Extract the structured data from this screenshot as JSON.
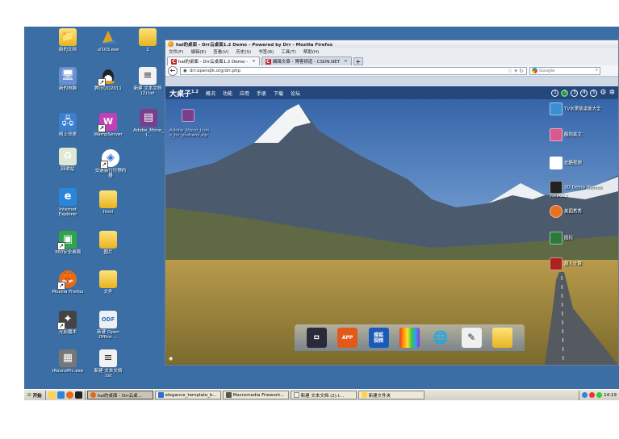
{
  "desktop": {
    "icons": [
      {
        "label": "新的文档",
        "color": "#ffd24a"
      },
      {
        "label": "ul103.exe",
        "color": "#d9a321"
      },
      {
        "label": "1",
        "color": "#ffd24a"
      },
      {
        "label": "新的电脑",
        "color": "#6a8fd0"
      },
      {
        "label": "腾讯QQ2011",
        "color": "#222222"
      },
      {
        "label": "新建 文本文档\n(2).txt",
        "color": "#f2f2f2"
      },
      {
        "label": "网上邻居",
        "color": "#3a7fd0"
      },
      {
        "label": "WampServer",
        "color": "#c23fb8"
      },
      {
        "label": "Adobe_Mono_I...",
        "color": "#7a3f8c"
      },
      {
        "label": "回收站",
        "color": "#dfe8d0"
      },
      {
        "label": "交通银行行预约\n器",
        "color": "#2e6fcf"
      },
      {
        "label": "Internet\nExplorer",
        "color": "#2a86d9"
      },
      {
        "label": "html",
        "color": "#ffd24a"
      },
      {
        "label": "360安全桌面",
        "color": "#2fa24a"
      },
      {
        "label": "图片",
        "color": "#ffd24a"
      },
      {
        "label": "Mozilla Firefox",
        "color": "#e26a1b"
      },
      {
        "label": "文件",
        "color": "#ffd24a"
      },
      {
        "label": "光影魔术",
        "color": "#444444"
      },
      {
        "label": "新建 Open\nOffice ...",
        "color": "#f0f0f0"
      },
      {
        "label": "iRoundPic.exe",
        "color": "#777777"
      },
      {
        "label": "新建 文本文档\n.txt",
        "color": "#f2f2f2"
      }
    ]
  },
  "taskbar": {
    "start": "开始",
    "buttons": [
      {
        "label": "hal的桌面 - Drr云桌...",
        "active": true,
        "color": "#e26a1b"
      },
      {
        "label": "elegance_template_b...",
        "active": false,
        "color": "#2e6fcf"
      },
      {
        "label": "Macromedia Firework...",
        "active": false,
        "color": "#555555"
      },
      {
        "label": "新建 文本文档 (2).t...",
        "active": false,
        "color": "#f2f2f2"
      },
      {
        "label": "新建文件夹",
        "active": false,
        "color": "#ffd24a"
      }
    ],
    "clock": "14:19"
  },
  "firefox": {
    "title": "hal的桌面 - Drr云桌面1.2 Demo - Powered by Drr - Mozilla Firefox",
    "menu": [
      "文件(F)",
      "编辑(E)",
      "查看(V)",
      "历史(S)",
      "书签(B)",
      "工具(T)",
      "帮助(H)"
    ],
    "tabs": [
      {
        "label": "hal的桌面 - Drr云桌面1.2 Demo -",
        "active": true,
        "icon": "C"
      },
      {
        "label": "编辑文章 - 博客频道 - CSDN.NET",
        "active": false,
        "icon": "C"
      }
    ],
    "url": "drr.openqlk.org/drr.php",
    "search_placeholder": "Google"
  },
  "webdesk": {
    "logo": "大桌子",
    "version": "1.2",
    "nav": [
      "概况",
      "功能",
      "应用",
      "手册",
      "下载",
      "论坛"
    ],
    "desktops": [
      "1",
      "2",
      "3",
      "4",
      "5"
    ],
    "file": "Adobe_Mono_Icon\ns_by_mohami.zip",
    "right_icons": [
      {
        "label": "TV水果版桌面大全",
        "color": "#3a8fd0"
      },
      {
        "label": "酷狗美文",
        "color": "#d85a8a"
      },
      {
        "label": "优酷视频",
        "color": "#ffffff"
      },
      {
        "label": "3D Demo (Needs WebGL)",
        "color": "#222222"
      },
      {
        "label": "美图秀秀",
        "color": "#e87020"
      },
      {
        "label": "图标",
        "color": "#2a7a3a"
      },
      {
        "label": "超人计算",
        "color": "#aa2222"
      }
    ],
    "dock": [
      {
        "label": "",
        "color": "#2a2a3a"
      },
      {
        "label": "APP",
        "color": "#e25a1a"
      },
      {
        "label": "搜狐\n视频",
        "color": "#1a5ab8"
      },
      {
        "label": "",
        "color": "#d03a8a"
      },
      {
        "label": "",
        "color": "#2a8ad0"
      },
      {
        "label": "",
        "color": "#f0f0f0"
      },
      {
        "label": "",
        "color": "#e8b320"
      }
    ]
  }
}
